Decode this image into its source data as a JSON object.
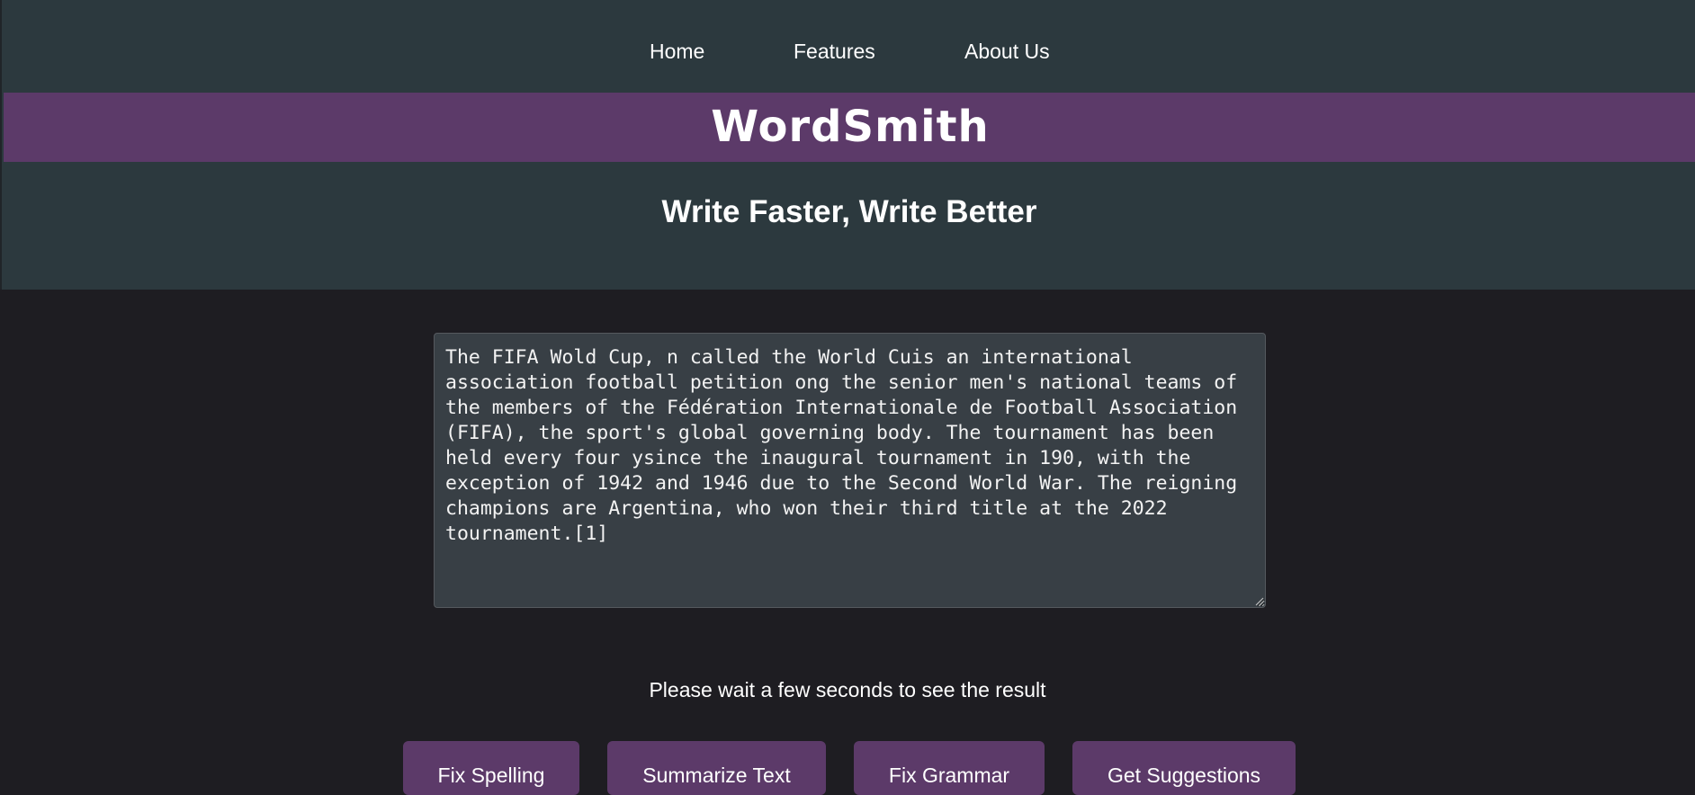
{
  "nav": {
    "items": [
      {
        "label": "Home"
      },
      {
        "label": "Features"
      },
      {
        "label": "About Us"
      }
    ]
  },
  "brand": {
    "title": "WordSmith",
    "accent_color": "#5c3a69"
  },
  "hero": {
    "tagline": "Write Faster, Write Better"
  },
  "editor": {
    "value": "The FIFA Wold Cup, n called the World Cuis an international association football petition ong the senior men's national teams of the members of the Fédération Internationale de Football Association (FIFA), the sport's global governing body. The tournament has been held every four ysince the inaugural tournament in 190, with the exception of 1942 and 1946 due to the Second World War. The reigning champions are Argentina, who won their third title at the 2022 tournament.[1]"
  },
  "status": {
    "message": "Please wait a few seconds to see the result"
  },
  "actions": {
    "fix_spelling": "Fix Spelling",
    "summarize": "Summarize Text",
    "fix_grammar": "Fix Grammar",
    "suggestions": "Get Suggestions"
  }
}
